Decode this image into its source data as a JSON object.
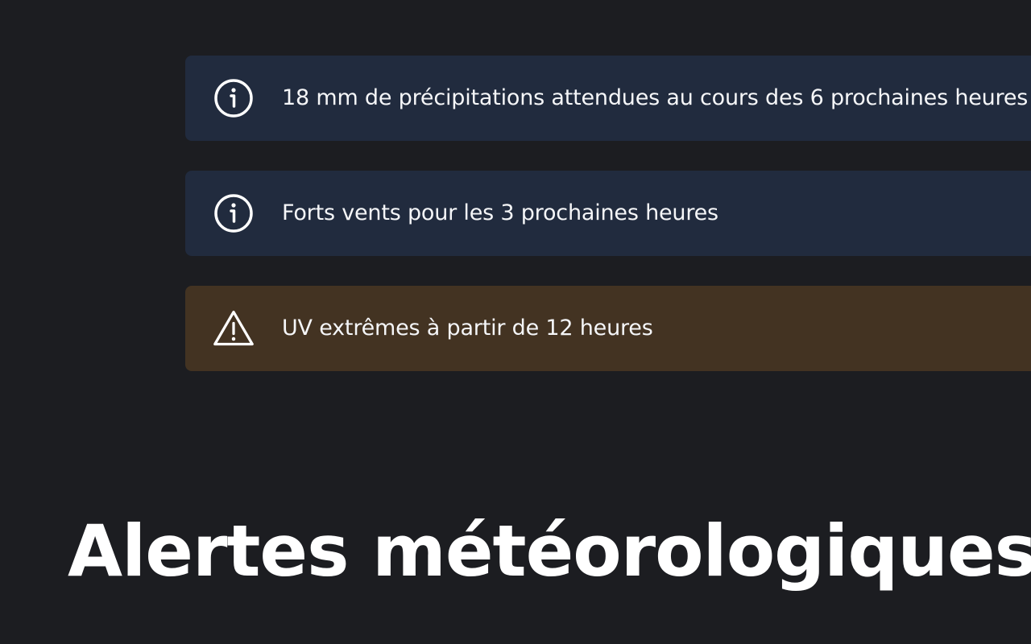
{
  "alerts": [
    {
      "type": "info",
      "icon": "info-icon",
      "text": "18 mm de précipitations attendues au cours des 6 prochaines heures"
    },
    {
      "type": "info",
      "icon": "info-icon",
      "text": "Forts vents pour les 3 prochaines heures"
    },
    {
      "type": "warning",
      "icon": "warning-icon",
      "text": "UV extrêmes à partir de 12 heures"
    }
  ],
  "title": "Alertes météorologiques",
  "colors": {
    "background": "#1c1d21",
    "info_card": "#212b3e",
    "warning_card": "#433322",
    "text": "#ffffff"
  }
}
